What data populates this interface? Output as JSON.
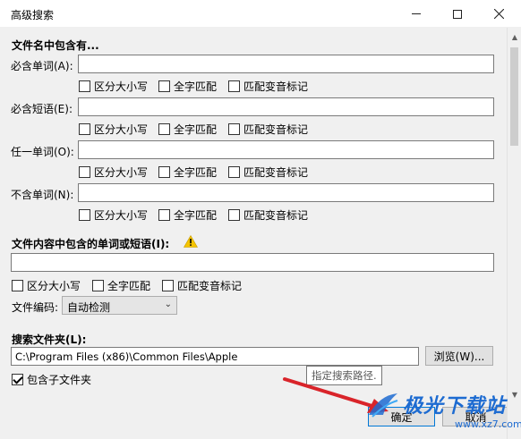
{
  "window": {
    "title": "高级搜索",
    "minimize_icon": "minimize-icon",
    "maximize_icon": "maximize-icon",
    "close_icon": "close-icon"
  },
  "filename_section": {
    "heading": "文件名中包含有...",
    "rows": [
      {
        "label": "必含单词(A):",
        "value": "",
        "options": [
          "区分大小写",
          "全字匹配",
          "匹配变音标记"
        ]
      },
      {
        "label": "必含短语(E):",
        "value": "",
        "options": [
          "区分大小写",
          "全字匹配",
          "匹配变音标记"
        ]
      },
      {
        "label": "任一单词(O):",
        "value": "",
        "options": [
          "区分大小写",
          "全字匹配",
          "匹配变音标记"
        ]
      },
      {
        "label": "不含单词(N):",
        "value": "",
        "options": [
          "区分大小写",
          "全字匹配",
          "匹配变音标记"
        ]
      }
    ]
  },
  "content_section": {
    "heading": "文件内容中包含的单词或短语(I):",
    "warning_icon": "warning-icon",
    "value": "",
    "options": [
      "区分大小写",
      "全字匹配",
      "匹配变音标记"
    ],
    "encoding_label": "文件编码:",
    "encoding_value": "自动检测"
  },
  "folder_section": {
    "heading": "搜索文件夹(L):",
    "path": "C:\\Program Files (x86)\\Common Files\\Apple",
    "browse_label": "浏览(W)...",
    "include_subfolders_label": "包含子文件夹",
    "include_subfolders_checked": true
  },
  "tooltip": "指定搜索路径.",
  "footer": {
    "ok_label": "确定",
    "cancel_label": "取消"
  },
  "watermark": {
    "text": "极光下载站",
    "url": "www.xz7.com"
  },
  "colors": {
    "dialog_bg": "#f0f0f0",
    "warning": "#f5c400",
    "accent": "#0078d7",
    "annotation_arrow": "#d9242a"
  }
}
